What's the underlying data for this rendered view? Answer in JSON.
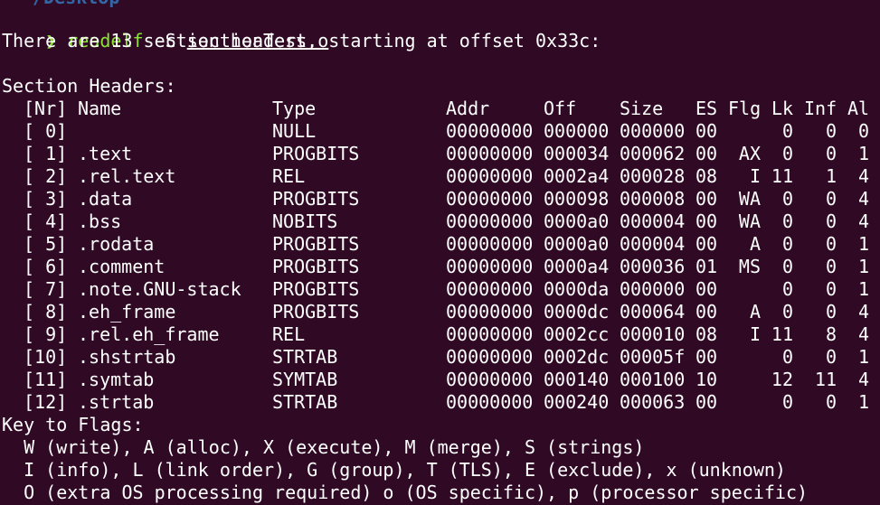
{
  "colors": {
    "background": "#300a24",
    "foreground": "#ffffff",
    "prompt_arrow": "#8ae234",
    "command": "#8ae234",
    "cwd": "#3465a4"
  },
  "prompt": {
    "cwd_line": "~/Desktop",
    "arrow": "❯",
    "command": "readelf",
    "args": " -S ",
    "file": "sectionTest.o"
  },
  "summary": "There are 13 section headers, starting at offset 0x33c:",
  "section_title": "Section Headers:",
  "header": {
    "nr": "[Nr]",
    "name": "Name",
    "type": "Type",
    "addr": "Addr",
    "off": "Off",
    "size": "Size",
    "es": "ES",
    "flg": "Flg",
    "lk": "Lk",
    "inf": "Inf",
    "al": "Al"
  },
  "rows": [
    {
      "nr": "[ 0]",
      "name": "",
      "type": "NULL",
      "addr": "00000000",
      "off": "000000",
      "size": "000000",
      "es": "00",
      "flg": "",
      "lk": "0",
      "inf": "0",
      "al": "0"
    },
    {
      "nr": "[ 1]",
      "name": ".text",
      "type": "PROGBITS",
      "addr": "00000000",
      "off": "000034",
      "size": "000062",
      "es": "00",
      "flg": "AX",
      "lk": "0",
      "inf": "0",
      "al": "1"
    },
    {
      "nr": "[ 2]",
      "name": ".rel.text",
      "type": "REL",
      "addr": "00000000",
      "off": "0002a4",
      "size": "000028",
      "es": "08",
      "flg": "I",
      "lk": "11",
      "inf": "1",
      "al": "4"
    },
    {
      "nr": "[ 3]",
      "name": ".data",
      "type": "PROGBITS",
      "addr": "00000000",
      "off": "000098",
      "size": "000008",
      "es": "00",
      "flg": "WA",
      "lk": "0",
      "inf": "0",
      "al": "4"
    },
    {
      "nr": "[ 4]",
      "name": ".bss",
      "type": "NOBITS",
      "addr": "00000000",
      "off": "0000a0",
      "size": "000004",
      "es": "00",
      "flg": "WA",
      "lk": "0",
      "inf": "0",
      "al": "4"
    },
    {
      "nr": "[ 5]",
      "name": ".rodata",
      "type": "PROGBITS",
      "addr": "00000000",
      "off": "0000a0",
      "size": "000004",
      "es": "00",
      "flg": "A",
      "lk": "0",
      "inf": "0",
      "al": "1"
    },
    {
      "nr": "[ 6]",
      "name": ".comment",
      "type": "PROGBITS",
      "addr": "00000000",
      "off": "0000a4",
      "size": "000036",
      "es": "01",
      "flg": "MS",
      "lk": "0",
      "inf": "0",
      "al": "1"
    },
    {
      "nr": "[ 7]",
      "name": ".note.GNU-stack",
      "type": "PROGBITS",
      "addr": "00000000",
      "off": "0000da",
      "size": "000000",
      "es": "00",
      "flg": "",
      "lk": "0",
      "inf": "0",
      "al": "1"
    },
    {
      "nr": "[ 8]",
      "name": ".eh_frame",
      "type": "PROGBITS",
      "addr": "00000000",
      "off": "0000dc",
      "size": "000064",
      "es": "00",
      "flg": "A",
      "lk": "0",
      "inf": "0",
      "al": "4"
    },
    {
      "nr": "[ 9]",
      "name": ".rel.eh_frame",
      "type": "REL",
      "addr": "00000000",
      "off": "0002cc",
      "size": "000010",
      "es": "08",
      "flg": "I",
      "lk": "11",
      "inf": "8",
      "al": "4"
    },
    {
      "nr": "[10]",
      "name": ".shstrtab",
      "type": "STRTAB",
      "addr": "00000000",
      "off": "0002dc",
      "size": "00005f",
      "es": "00",
      "flg": "",
      "lk": "0",
      "inf": "0",
      "al": "1"
    },
    {
      "nr": "[11]",
      "name": ".symtab",
      "type": "SYMTAB",
      "addr": "00000000",
      "off": "000140",
      "size": "000100",
      "es": "10",
      "flg": "",
      "lk": "12",
      "inf": "11",
      "al": "4"
    },
    {
      "nr": "[12]",
      "name": ".strtab",
      "type": "STRTAB",
      "addr": "00000000",
      "off": "000240",
      "size": "000063",
      "es": "00",
      "flg": "",
      "lk": "0",
      "inf": "0",
      "al": "1"
    }
  ],
  "flags_key": {
    "title": "Key to Flags:",
    "lines": [
      "  W (write), A (alloc), X (execute), M (merge), S (strings)",
      "  I (info), L (link order), G (group), T (TLS), E (exclude), x (unknown)",
      "  O (extra OS processing required) o (OS specific), p (processor specific)"
    ]
  }
}
